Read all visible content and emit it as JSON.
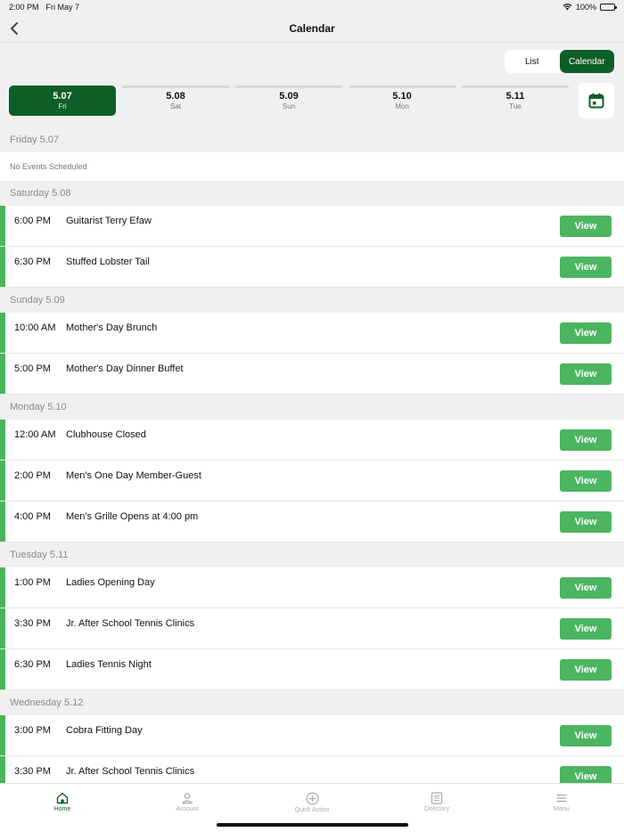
{
  "status_bar": {
    "time": "2:00 PM",
    "date": "Fri May 7",
    "battery": "100%"
  },
  "nav": {
    "title": "Calendar"
  },
  "view_toggle": {
    "list_label": "List",
    "calendar_label": "Calendar",
    "selected": "Calendar"
  },
  "date_strip": [
    {
      "date": "5.07",
      "day": "Fri",
      "active": true
    },
    {
      "date": "5.08",
      "day": "Sat",
      "active": false
    },
    {
      "date": "5.09",
      "day": "Sun",
      "active": false
    },
    {
      "date": "5.10",
      "day": "Mon",
      "active": false
    },
    {
      "date": "5.11",
      "day": "Tue",
      "active": false
    }
  ],
  "sections": [
    {
      "header": "Friday 5.07",
      "empty_text": "No Events Scheduled",
      "events": []
    },
    {
      "header": "Saturday 5.08",
      "events": [
        {
          "time": "6:00 PM",
          "name": "Guitarist Terry Efaw",
          "button": "View"
        },
        {
          "time": "6:30 PM",
          "name": "Stuffed Lobster Tail",
          "button": "View"
        }
      ]
    },
    {
      "header": "Sunday 5.09",
      "events": [
        {
          "time": "10:00 AM",
          "name": "Mother's Day Brunch",
          "button": "View"
        },
        {
          "time": "5:00 PM",
          "name": "Mother's Day Dinner Buffet",
          "button": "View"
        }
      ]
    },
    {
      "header": "Monday 5.10",
      "events": [
        {
          "time": "12:00 AM",
          "name": "Clubhouse Closed",
          "button": "View"
        },
        {
          "time": "2:00 PM",
          "name": "Men's One Day Member-Guest",
          "button": "View"
        },
        {
          "time": "4:00 PM",
          "name": "Men's Grille Opens at 4:00 pm",
          "button": "View"
        }
      ]
    },
    {
      "header": "Tuesday 5.11",
      "events": [
        {
          "time": "1:00 PM",
          "name": "Ladies Opening Day",
          "button": "View"
        },
        {
          "time": "3:30 PM",
          "name": "Jr. After School Tennis Clinics",
          "button": "View"
        },
        {
          "time": "6:30 PM",
          "name": "Ladies Tennis Night",
          "button": "View"
        }
      ]
    },
    {
      "header": "Wednesday 5.12",
      "events": [
        {
          "time": "3:00 PM",
          "name": "Cobra Fitting Day",
          "button": "View"
        },
        {
          "time": "3:30 PM",
          "name": "Jr. After School Tennis Clinics",
          "button": "View"
        }
      ]
    }
  ],
  "tab_bar": [
    {
      "label": "Home",
      "icon": "home-icon",
      "active": true
    },
    {
      "label": "Account",
      "icon": "account-icon",
      "active": false
    },
    {
      "label": "Quick Action",
      "icon": "plus-circle-icon",
      "active": false
    },
    {
      "label": "Directory",
      "icon": "directory-icon",
      "active": false
    },
    {
      "label": "Menu",
      "icon": "menu-icon",
      "active": false
    }
  ],
  "colors": {
    "brand_green": "#0e5e27",
    "accent_green": "#4cb561",
    "event_bar": "#49b558"
  }
}
